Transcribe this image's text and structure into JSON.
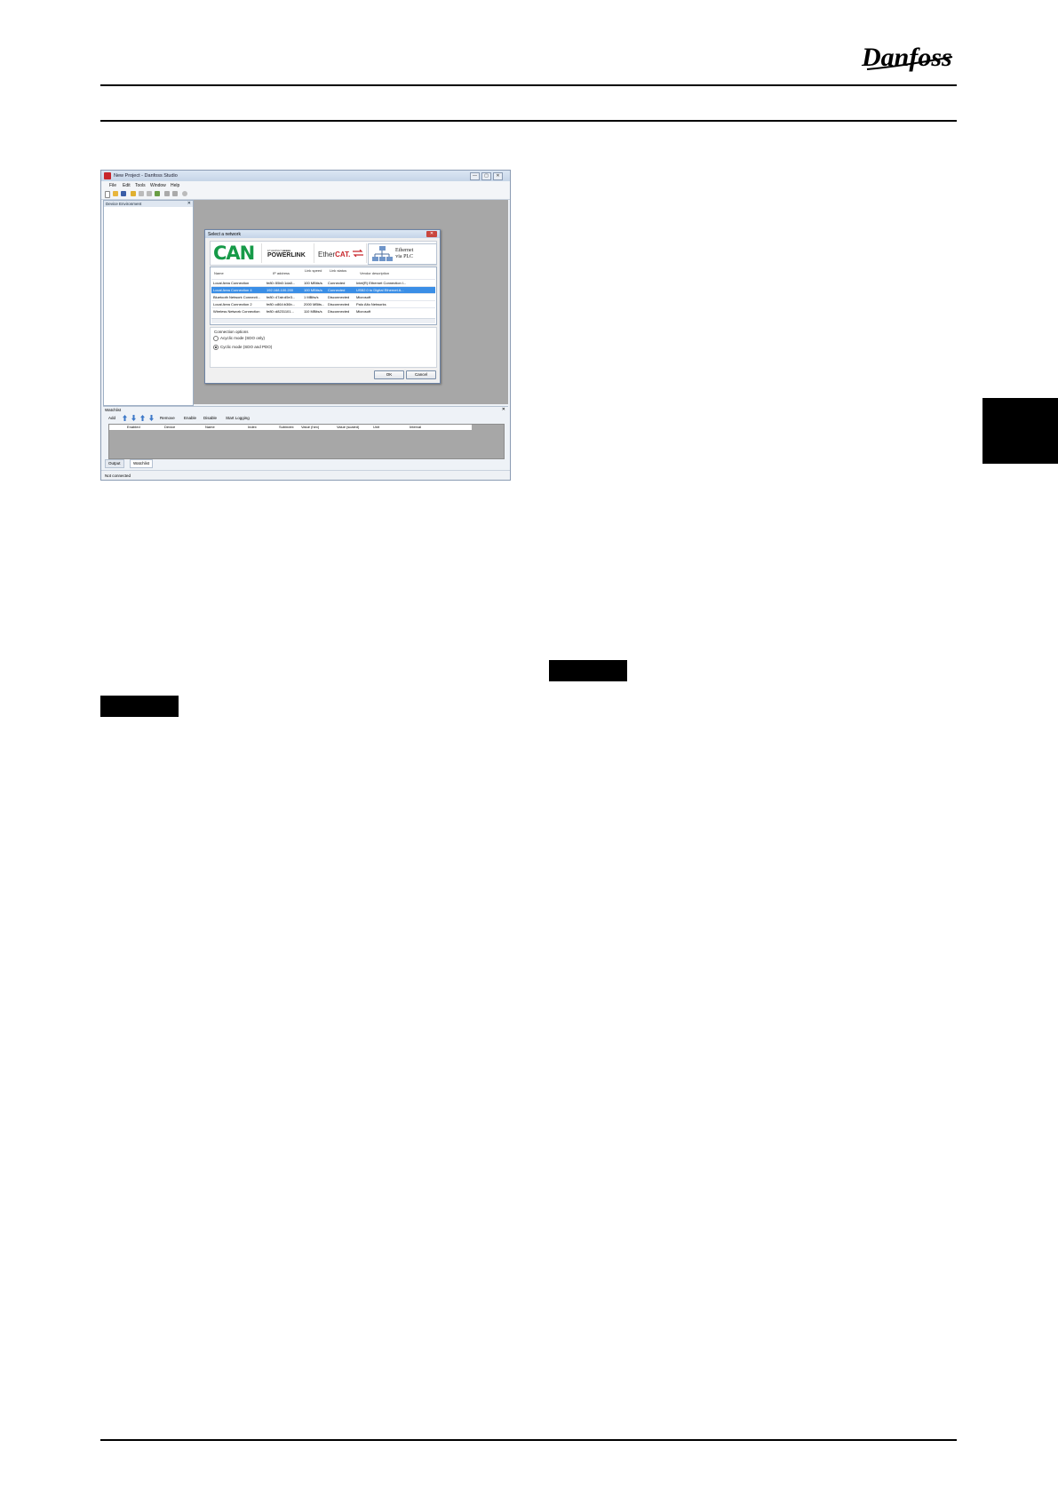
{
  "brand": "Danfoss",
  "app": {
    "title": "New Project - Danfoss Studio",
    "window_buttons": [
      "—",
      "▢",
      "✕"
    ],
    "menu": [
      "File",
      "Edit",
      "Tools",
      "Window",
      "Help"
    ],
    "device_pane_title": "Device Environment"
  },
  "dialog": {
    "title": "Select a network",
    "close": "✕",
    "logos": {
      "can": "CAN",
      "powerlink_small": "ETHERNET ■■■■■",
      "powerlink": "POWERLINK",
      "ethercat_a": "Ether",
      "ethercat_b": "CAT.",
      "ethernet_plc_line1": "Ethernet",
      "ethernet_plc_line2": "via PLC"
    },
    "columns": [
      "Name",
      "IP address",
      "Link speed",
      "Link status",
      "Vendor description"
    ],
    "rows": [
      [
        "Local Area Connection",
        "fe80::55b0:1da0...",
        "100 MBits/s",
        "Connected",
        "Intel(R) Ethernet Connection I..."
      ],
      [
        "Local Area Connection 4",
        "192.168.100.200",
        "100 MBits/s",
        "Connected",
        "USB2.0 to Digital Ethernet A..."
      ],
      [
        "Bluetooth Network Connecti...",
        "fe80::47ab:d5e3...",
        "1 MBits/s",
        "Disconnected",
        "Microsoft"
      ],
      [
        "Local Area Connection 2",
        "fe80::c864:b36b...",
        "2000 MBits...",
        "Disconnected",
        "Palo Alto Networks"
      ],
      [
        "Wireless Network Connection",
        "fe80::d8231101...",
        "110 MBits/s",
        "Disconnected",
        "Microsoft"
      ]
    ],
    "selected_row": 1,
    "options_label": "Connection options",
    "option_acyclic": "Acyclic mode (SDO only)",
    "option_cyclic": "Cyclic mode (SDO and PDO)",
    "ok": "OK",
    "cancel": "Cancel"
  },
  "watchlist": {
    "title": "Watchlist",
    "add": "Add",
    "remove": "Remove",
    "enable": "Enable",
    "disable": "Disable",
    "start_logging": "Start Logging",
    "columns": [
      "Enabled",
      "Device",
      "Name",
      "Index",
      "Subindex",
      "Value (hex)",
      "Value (scaled)",
      "Unit",
      "Interval"
    ]
  },
  "tabs": {
    "output": "Output",
    "watchlist": "Watchlist"
  },
  "status": "Not connected"
}
